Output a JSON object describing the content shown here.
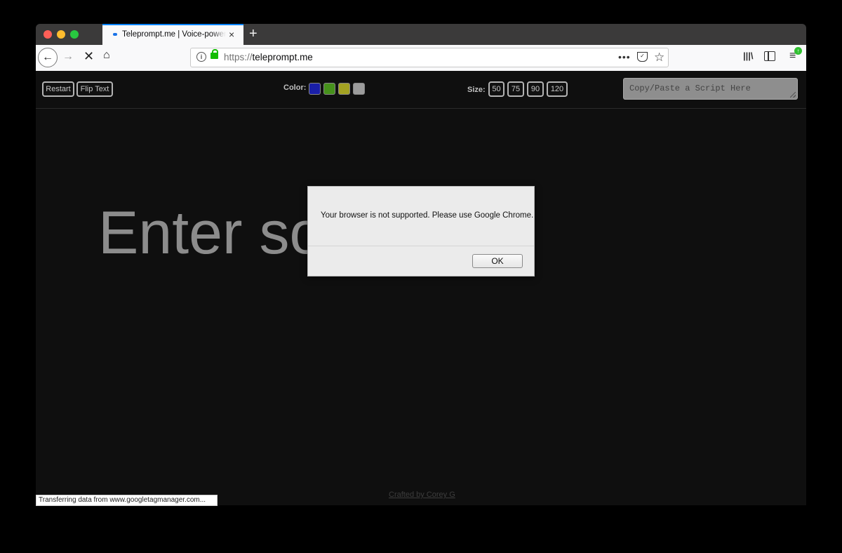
{
  "browser": {
    "tab": {
      "title": "Teleprompt.me | Voice-powered",
      "close_icon": "×"
    },
    "new_tab_icon": "+",
    "nav": {
      "back_icon": "←",
      "forward_icon": "→",
      "stop_icon": "✕",
      "home_icon": "⌂"
    },
    "url": {
      "scheme": "https://",
      "host": "teleprompt.me"
    },
    "url_more_icon": "•••",
    "url_pocket_icon": "",
    "url_star_icon": "☆",
    "library_icon": "|||\\",
    "menu_icon": "≡",
    "update_icon": "↑"
  },
  "toolbar": {
    "restart_label": "Restart",
    "flip_label": "Flip Text",
    "color_label": "Color:",
    "colors": [
      "#1a1fa8",
      "#46911b",
      "#a3a222",
      "#9c9c9c"
    ],
    "size_label": "Size:",
    "sizes": [
      "50",
      "75",
      "90",
      "120"
    ],
    "script_placeholder": "Copy/Paste a Script Here"
  },
  "main": {
    "prompt_text": "Enter some text",
    "footer": "Crafted by Corey G"
  },
  "status": {
    "text": "Transferring data from www.googletagmanager.com..."
  },
  "dialog": {
    "message": "Your browser is not supported. Please use Google Chrome.",
    "ok_label": "OK"
  }
}
